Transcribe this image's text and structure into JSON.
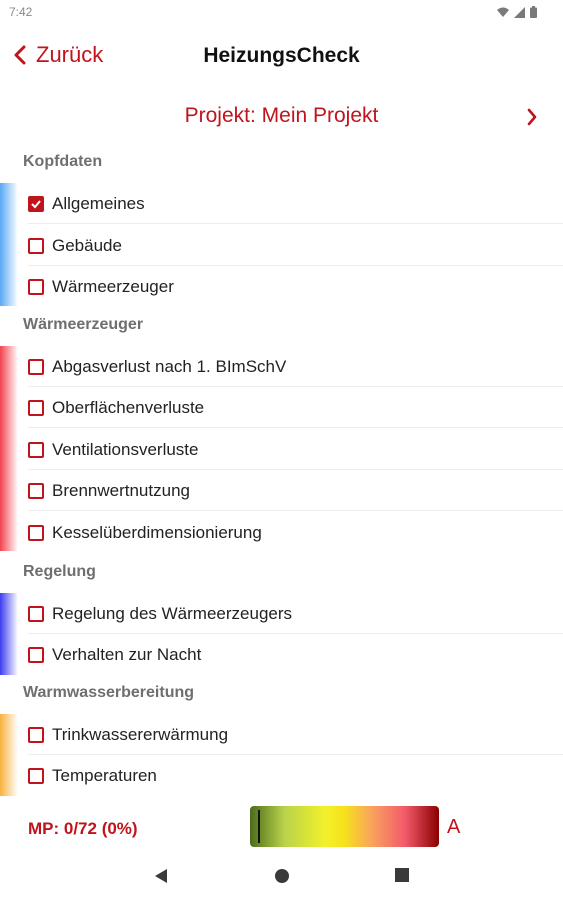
{
  "status": {
    "time": "7:42"
  },
  "nav": {
    "back_label": "Zurück",
    "title": "HeizungsCheck"
  },
  "project": {
    "label": "Projekt: Mein Projekt"
  },
  "sections": [
    {
      "title": "Kopfdaten",
      "color": "#5aa8f5",
      "items": [
        {
          "label": "Allgemeines",
          "checked": true
        },
        {
          "label": "Gebäude",
          "checked": false
        },
        {
          "label": "Wärmeerzeuger",
          "checked": false
        }
      ]
    },
    {
      "title": "Wärmeerzeuger",
      "color": "#f2434f",
      "items": [
        {
          "label": "Abgasverlust nach 1. BImSchV",
          "checked": false
        },
        {
          "label": "Oberflächenverluste",
          "checked": false
        },
        {
          "label": "Ventilationsverluste",
          "checked": false
        },
        {
          "label": "Brennwertnutzung",
          "checked": false
        },
        {
          "label": "Kesselüberdimensionierung",
          "checked": false
        }
      ]
    },
    {
      "title": "Regelung",
      "color": "#3d3df0",
      "items": [
        {
          "label": "Regelung des Wärmeerzeugers",
          "checked": false
        },
        {
          "label": "Verhalten zur Nacht",
          "checked": false
        }
      ]
    },
    {
      "title": "Warmwasserbereitung",
      "color": "#f7b23e",
      "items": [
        {
          "label": "Trinkwassererwärmung",
          "checked": false
        },
        {
          "label": "Temperaturen",
          "checked": false
        }
      ]
    }
  ],
  "footer": {
    "mp_label": "MP: 0/72 (0%)",
    "grade": "A",
    "score_fraction": 0.0
  },
  "colors": {
    "accent": "#c0141c"
  }
}
